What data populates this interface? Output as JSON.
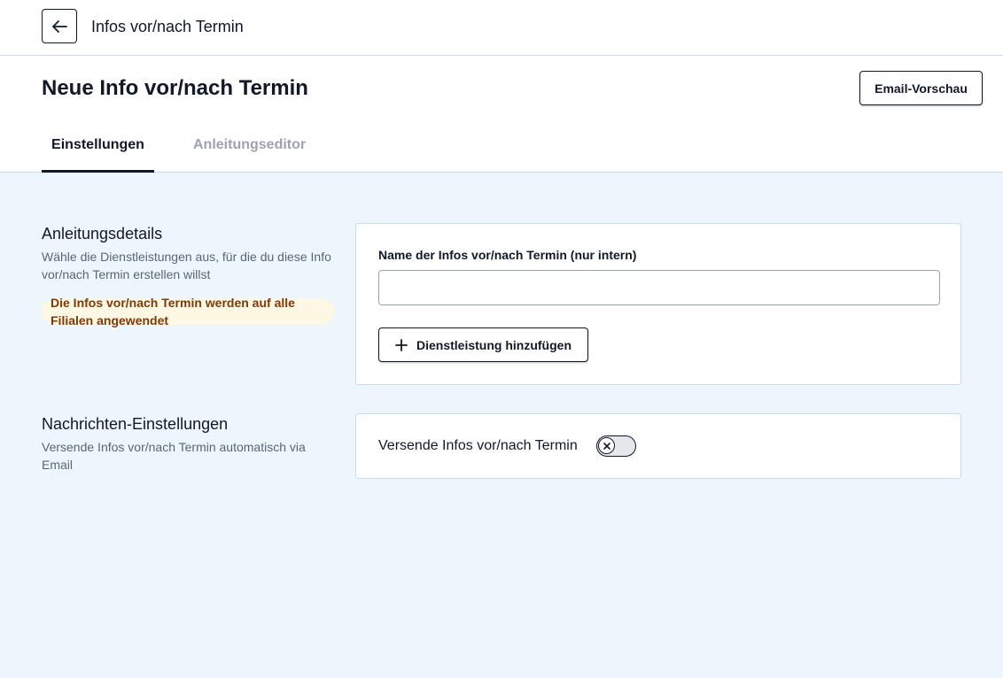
{
  "header": {
    "title": "Infos vor/nach Termin",
    "back_icon": "arrow-left-icon"
  },
  "page": {
    "title": "Neue Info vor/nach Termin",
    "preview_button": "Email-Vorschau"
  },
  "tabs": [
    {
      "label": "Einstellungen",
      "active": true
    },
    {
      "label": "Anleitungseditor",
      "active": false
    }
  ],
  "details": {
    "title": "Anleitungsdetails",
    "description": "Wähle die Dienstleistungen aus, für die du diese Info vor/nach Termin erstellen willst",
    "notice": "Die Infos vor/nach Termin werden auf alle Filialen angewendet",
    "name_label": "Name der Infos vor/nach Termin (nur intern)",
    "name_value": "",
    "add_service_button": "Dienstleistung hinzufügen"
  },
  "messages": {
    "title": "Nachrichten-Einstellungen",
    "description": "Versende Infos vor/nach Termin automatisch via Email",
    "toggle_label": "Versende Infos vor/nach Termin",
    "toggle_on": false
  },
  "colors": {
    "page_background": "#eef6fd",
    "notice_background": "#fdf8e3",
    "notice_text": "#7c3a0a",
    "border": "#c9dcef",
    "inactive_tab": "#9ca3af"
  }
}
